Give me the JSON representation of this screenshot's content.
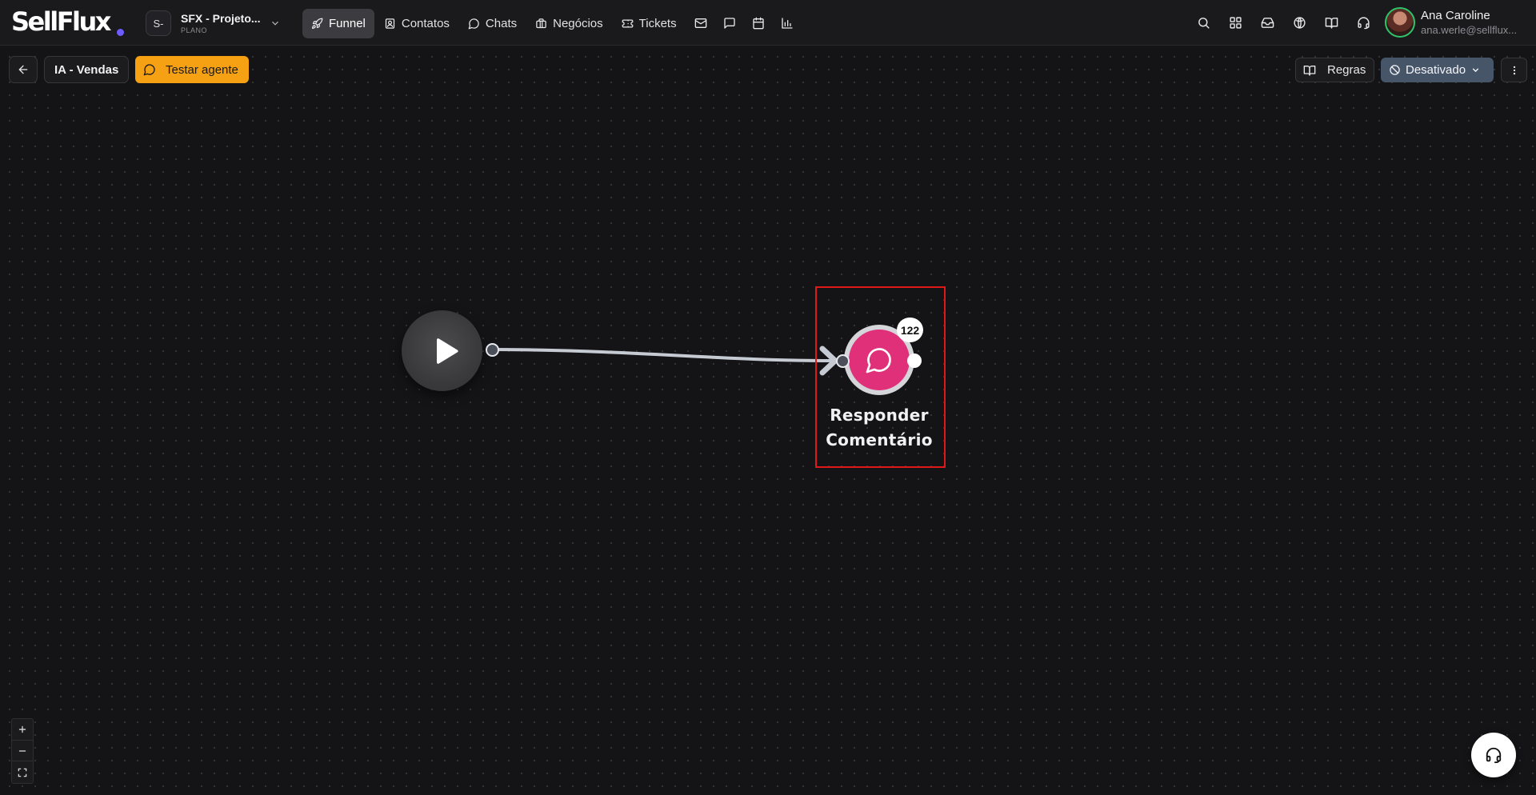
{
  "brand": {
    "logo_text": "SellFlux",
    "accent_color": "#6d5cff"
  },
  "project": {
    "avatar_text": "S-",
    "name": "SFX - Projeto...",
    "plan": "PLANO"
  },
  "nav": {
    "items": [
      {
        "label": "Funnel",
        "icon": "rocket-icon",
        "active": true
      },
      {
        "label": "Contatos",
        "icon": "contacts-icon",
        "active": false
      },
      {
        "label": "Chats",
        "icon": "chat-bubble-icon",
        "active": false
      },
      {
        "label": "Negócios",
        "icon": "briefcase-icon",
        "active": false
      },
      {
        "label": "Tickets",
        "icon": "ticket-icon",
        "active": false
      }
    ],
    "icon_buttons": [
      "mail-icon",
      "message-square-icon",
      "calendar-icon",
      "bar-chart-icon"
    ]
  },
  "header_right_icons": [
    "search-icon",
    "grid-icon",
    "inbox-icon",
    "globe-icon",
    "book-icon",
    "headset-icon"
  ],
  "user": {
    "name": "Ana Caroline",
    "email": "ana.werle@sellflux..."
  },
  "toolbar": {
    "agent_name": "IA - Vendas",
    "test_label": "Testar agente",
    "test_color": "#f6a113",
    "rules_label": "Regras",
    "status_label": "Desativado",
    "status_color": "#475569"
  },
  "flow": {
    "start_node": {
      "icon": "play-icon"
    },
    "action_node": {
      "label_line1": "Responder",
      "label_line2": "Comentário",
      "count": "122",
      "icon": "message-circle-icon",
      "color": "#e0307a"
    }
  },
  "zoom_controls": [
    "zoom-in-icon",
    "zoom-out-icon",
    "fit-view-icon"
  ],
  "support": {
    "icon": "headset-icon"
  }
}
